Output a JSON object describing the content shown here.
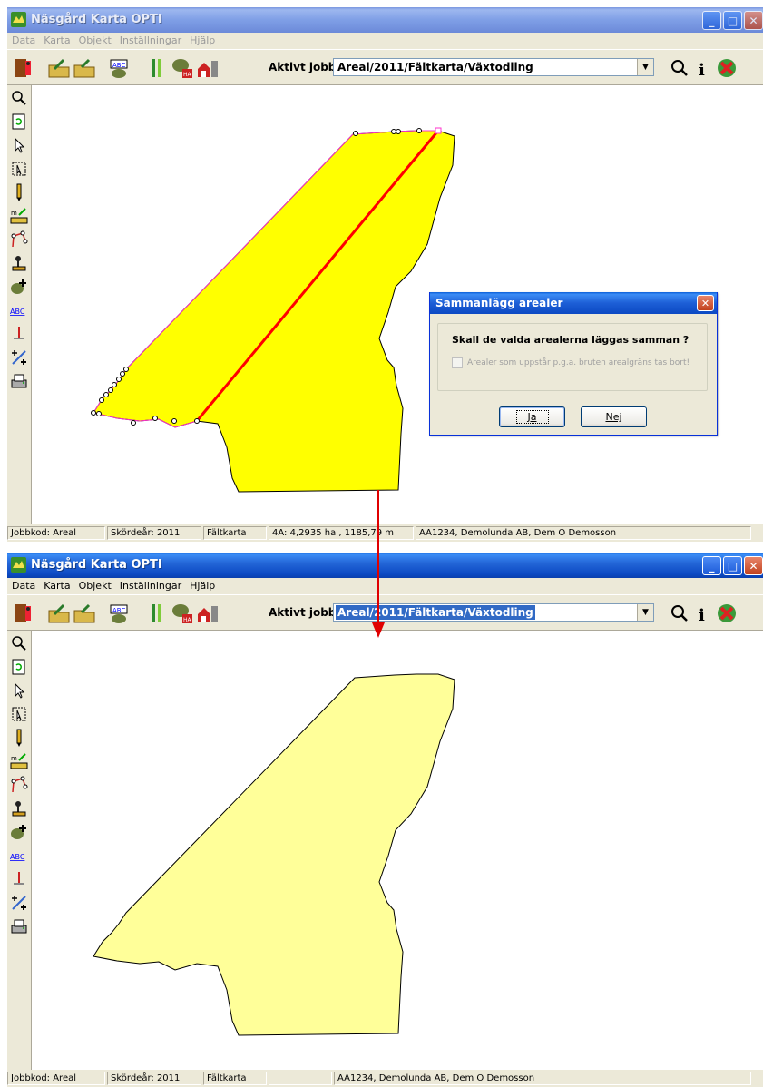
{
  "window_top": {
    "title": "Näsgård Karta OPTI",
    "menu": [
      "Data",
      "Karta",
      "Objekt",
      "Inställningar",
      "Hjälp"
    ],
    "job_label": "Aktivt jobb",
    "job_value": "Areal/2011/Fältkarta/Växtodling",
    "status": [
      "Jobbkod: Areal",
      "Skördeår: 2011",
      "Fältkarta",
      "4A: 4,2935 ha , 1185,79 m",
      "AA1234, Demolunda AB, Dem O Demosson"
    ]
  },
  "window_bottom": {
    "title": "Näsgård Karta OPTI",
    "menu": [
      "Data",
      "Karta",
      "Objekt",
      "Inställningar",
      "Hjälp"
    ],
    "job_label": "Aktivt jobb",
    "job_value": "Areal/2011/Fältkarta/Växtodling",
    "status": [
      "Jobbkod: Areal",
      "Skördeår: 2011",
      "Fältkarta",
      "",
      "AA1234, Demolunda AB, Dem O Demosson"
    ]
  },
  "dialog": {
    "title": "Sammanlägg arealer",
    "question": "Skall de valda arealerna läggas samman ?",
    "checkbox_label": "Arealer som uppstår p.g.a. bruten arealgräns tas bort!",
    "checkbox_checked": false,
    "yes_label": "Ja",
    "no_label": "Nej"
  },
  "colors": {
    "field_selected": "#ffff00",
    "field_merged": "#ffff99",
    "split_line": "#ff0000",
    "boundary_selected": "#ff33cc",
    "arrow": "#e00000"
  },
  "icons": {
    "toolbar": [
      "exit-icon",
      "import-icon",
      "export-icon",
      "abc-map-icon",
      "crop-icon",
      "area-ha-icon",
      "farm-icon"
    ],
    "toolbar_right": [
      "search-icon",
      "info-icon",
      "close-job-icon"
    ],
    "sidebar": [
      "zoom-icon",
      "refresh-icon",
      "pointer-icon",
      "select-area-icon",
      "pencil-icon",
      "measure-icon",
      "node-edit-icon",
      "joystick-icon",
      "add-area-icon",
      "abc-text-icon",
      "marker-icon",
      "split-add-icon",
      "print-icon"
    ]
  }
}
